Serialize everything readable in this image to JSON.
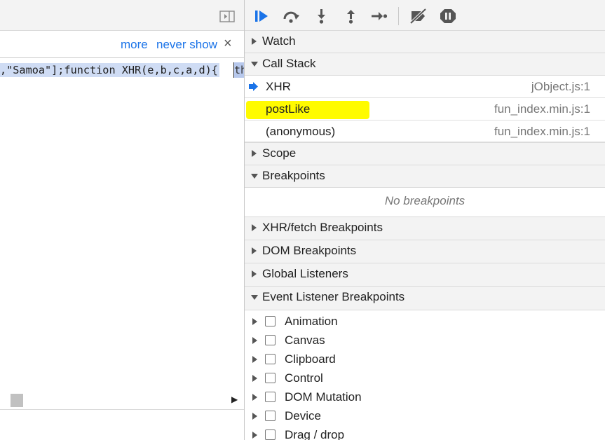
{
  "left_pane": {
    "infobar": {
      "more_label": "more",
      "never_show_label": "never show",
      "close_glyph": "×"
    },
    "code": {
      "text": ",\"Samoa\"];function XHR(e,b,c,a,d){",
      "selected_text": "th"
    },
    "scroll_right_glyph": "▶"
  },
  "toolbar": {
    "buttons": [
      {
        "name": "resume-icon",
        "color": "#1a73e8"
      },
      {
        "name": "step-over-icon",
        "color": "#555555"
      },
      {
        "name": "step-into-icon",
        "color": "#555555"
      },
      {
        "name": "step-out-icon",
        "color": "#555555"
      },
      {
        "name": "step-icon",
        "color": "#555555"
      },
      {
        "name": "deactivate-breakpoints-icon",
        "color": "#555555"
      },
      {
        "name": "pause-on-exceptions-icon",
        "color": "#555555"
      }
    ]
  },
  "sections": {
    "watch": {
      "title": "Watch",
      "expanded": false
    },
    "call_stack": {
      "title": "Call Stack",
      "expanded": true,
      "frames": [
        {
          "name": "XHR",
          "location": "jObject.js:1",
          "current": true
        },
        {
          "name": "postLike",
          "location": "fun_index.min.js:1",
          "highlighted": true
        },
        {
          "name": "(anonymous)",
          "location": "fun_index.min.js:1"
        }
      ]
    },
    "scope": {
      "title": "Scope",
      "expanded": false
    },
    "breakpoints": {
      "title": "Breakpoints",
      "expanded": true,
      "empty_text": "No breakpoints"
    },
    "xhr_breakpoints": {
      "title": "XHR/fetch Breakpoints",
      "expanded": false
    },
    "dom_breakpoints": {
      "title": "DOM Breakpoints",
      "expanded": false
    },
    "global_listeners": {
      "title": "Global Listeners",
      "expanded": false
    },
    "event_listener_breakpoints": {
      "title": "Event Listener Breakpoints",
      "expanded": true,
      "items": [
        "Animation",
        "Canvas",
        "Clipboard",
        "Control",
        "DOM Mutation",
        "Device",
        "Drag / drop"
      ]
    }
  },
  "colors": {
    "accent": "#1a73e8",
    "highlight": "#fffb00",
    "selection": "#cfdcf4"
  }
}
